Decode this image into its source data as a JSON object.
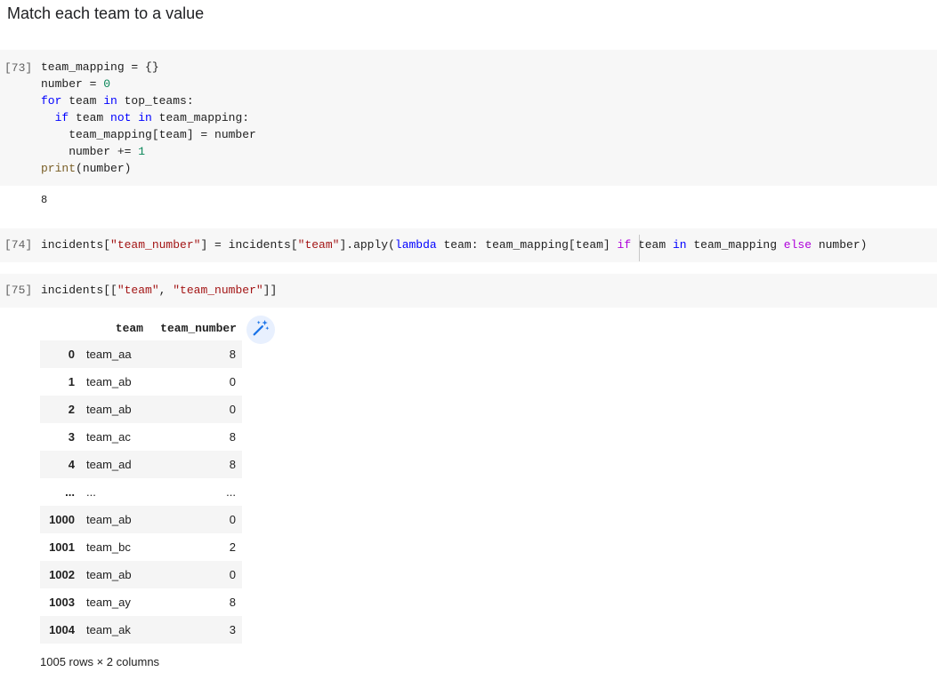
{
  "markdown": {
    "heading": "Match each team to a value"
  },
  "cells": [
    {
      "prompt": "[73]",
      "code_lines": [
        [
          {
            "t": "team_mapping = {}",
            "c": ""
          }
        ],
        [
          {
            "t": "number = ",
            "c": ""
          },
          {
            "t": "0",
            "c": "num"
          }
        ],
        [
          {
            "t": "for",
            "c": "kw"
          },
          {
            "t": " team ",
            "c": ""
          },
          {
            "t": "in",
            "c": "kw"
          },
          {
            "t": " top_teams:",
            "c": ""
          }
        ],
        [
          {
            "t": "  ",
            "c": ""
          },
          {
            "t": "if",
            "c": "kw"
          },
          {
            "t": " team ",
            "c": ""
          },
          {
            "t": "not",
            "c": "kw"
          },
          {
            "t": " ",
            "c": ""
          },
          {
            "t": "in",
            "c": "kw"
          },
          {
            "t": " team_mapping:",
            "c": ""
          }
        ],
        [
          {
            "t": "    team_mapping[team] = number",
            "c": ""
          }
        ],
        [
          {
            "t": "    number += ",
            "c": ""
          },
          {
            "t": "1",
            "c": "num"
          }
        ],
        [
          {
            "t": "print",
            "c": "fn"
          },
          {
            "t": "(number)",
            "c": ""
          }
        ]
      ],
      "output": "8"
    },
    {
      "prompt": "[74]",
      "code_lines": [
        [
          {
            "t": "incidents[",
            "c": ""
          },
          {
            "t": "\"team_number\"",
            "c": "str"
          },
          {
            "t": "] = incidents[",
            "c": ""
          },
          {
            "t": "\"team\"",
            "c": "str"
          },
          {
            "t": "].apply(",
            "c": ""
          },
          {
            "t": "lambda",
            "c": "kw"
          },
          {
            "t": " team: team_mapping[team] ",
            "c": ""
          },
          {
            "t": "if",
            "c": "kw2"
          },
          {
            "t": " team ",
            "c": ""
          },
          {
            "t": "in",
            "c": "kw"
          },
          {
            "t": " team_mapping ",
            "c": ""
          },
          {
            "t": "else",
            "c": "kw2"
          },
          {
            "t": " number)",
            "c": ""
          }
        ]
      ]
    },
    {
      "prompt": "[75]",
      "code_lines": [
        [
          {
            "t": "incidents[[",
            "c": ""
          },
          {
            "t": "\"team\"",
            "c": "str"
          },
          {
            "t": ", ",
            "c": ""
          },
          {
            "t": "\"team_number\"",
            "c": "str"
          },
          {
            "t": "]]",
            "c": ""
          }
        ]
      ]
    }
  ],
  "dataframe": {
    "columns": [
      "team",
      "team_number"
    ],
    "rows": [
      {
        "idx": "0",
        "team": "team_aa",
        "team_number": "8"
      },
      {
        "idx": "1",
        "team": "team_ab",
        "team_number": "0"
      },
      {
        "idx": "2",
        "team": "team_ab",
        "team_number": "0"
      },
      {
        "idx": "3",
        "team": "team_ac",
        "team_number": "8"
      },
      {
        "idx": "4",
        "team": "team_ad",
        "team_number": "8"
      },
      {
        "idx": "...",
        "team": "...",
        "team_number": "..."
      },
      {
        "idx": "1000",
        "team": "team_ab",
        "team_number": "0"
      },
      {
        "idx": "1001",
        "team": "team_bc",
        "team_number": "2"
      },
      {
        "idx": "1002",
        "team": "team_ab",
        "team_number": "0"
      },
      {
        "idx": "1003",
        "team": "team_ay",
        "team_number": "8"
      },
      {
        "idx": "1004",
        "team": "team_ak",
        "team_number": "3"
      }
    ],
    "footer": "1005 rows × 2 columns",
    "magic_icon": "magic-wand-icon",
    "accent_color": "#1a73e8"
  }
}
